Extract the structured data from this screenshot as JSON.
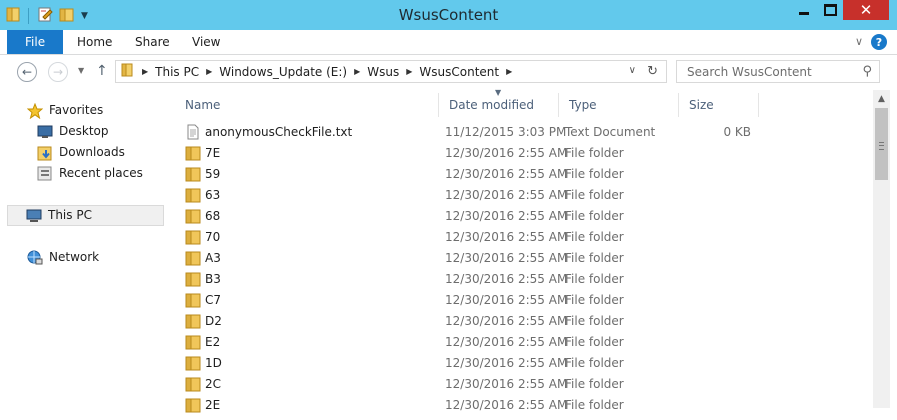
{
  "window": {
    "title": "WsusContent"
  },
  "colors": {
    "titlebar": "#62c9ec",
    "file_tab": "#1979ca",
    "close_button": "#c7302b",
    "folder": "#f0c65a"
  },
  "ribbon": {
    "tabs": [
      "File",
      "Home",
      "Share",
      "View"
    ]
  },
  "address": {
    "crumbs": [
      "This PC",
      "Windows_Update (E:)",
      "Wsus",
      "WsusContent"
    ]
  },
  "search": {
    "placeholder": "Search WsusContent"
  },
  "navpane": {
    "favorites": "Favorites",
    "favorites_items": [
      "Desktop",
      "Downloads",
      "Recent places"
    ],
    "this_pc": "This PC",
    "network": "Network"
  },
  "columns": {
    "name": "Name",
    "date": "Date modified",
    "type": "Type",
    "size": "Size"
  },
  "files": [
    {
      "name": "anonymousCheckFile.txt",
      "date": "11/12/2015 3:03 PM",
      "type": "Text Document",
      "size": "0 KB",
      "icon": "text-file-icon"
    },
    {
      "name": "7E",
      "date": "12/30/2016 2:55 AM",
      "type": "File folder",
      "size": "",
      "icon": "folder-icon"
    },
    {
      "name": "59",
      "date": "12/30/2016 2:55 AM",
      "type": "File folder",
      "size": "",
      "icon": "folder-icon"
    },
    {
      "name": "63",
      "date": "12/30/2016 2:55 AM",
      "type": "File folder",
      "size": "",
      "icon": "folder-icon"
    },
    {
      "name": "68",
      "date": "12/30/2016 2:55 AM",
      "type": "File folder",
      "size": "",
      "icon": "folder-icon"
    },
    {
      "name": "70",
      "date": "12/30/2016 2:55 AM",
      "type": "File folder",
      "size": "",
      "icon": "folder-icon"
    },
    {
      "name": "A3",
      "date": "12/30/2016 2:55 AM",
      "type": "File folder",
      "size": "",
      "icon": "folder-icon"
    },
    {
      "name": "B3",
      "date": "12/30/2016 2:55 AM",
      "type": "File folder",
      "size": "",
      "icon": "folder-icon"
    },
    {
      "name": "C7",
      "date": "12/30/2016 2:55 AM",
      "type": "File folder",
      "size": "",
      "icon": "folder-icon"
    },
    {
      "name": "D2",
      "date": "12/30/2016 2:55 AM",
      "type": "File folder",
      "size": "",
      "icon": "folder-icon"
    },
    {
      "name": "E2",
      "date": "12/30/2016 2:55 AM",
      "type": "File folder",
      "size": "",
      "icon": "folder-icon"
    },
    {
      "name": "1D",
      "date": "12/30/2016 2:55 AM",
      "type": "File folder",
      "size": "",
      "icon": "folder-icon"
    },
    {
      "name": "2C",
      "date": "12/30/2016 2:55 AM",
      "type": "File folder",
      "size": "",
      "icon": "folder-icon"
    },
    {
      "name": "2E",
      "date": "12/30/2016 2:55 AM",
      "type": "File folder",
      "size": "",
      "icon": "folder-icon"
    }
  ]
}
